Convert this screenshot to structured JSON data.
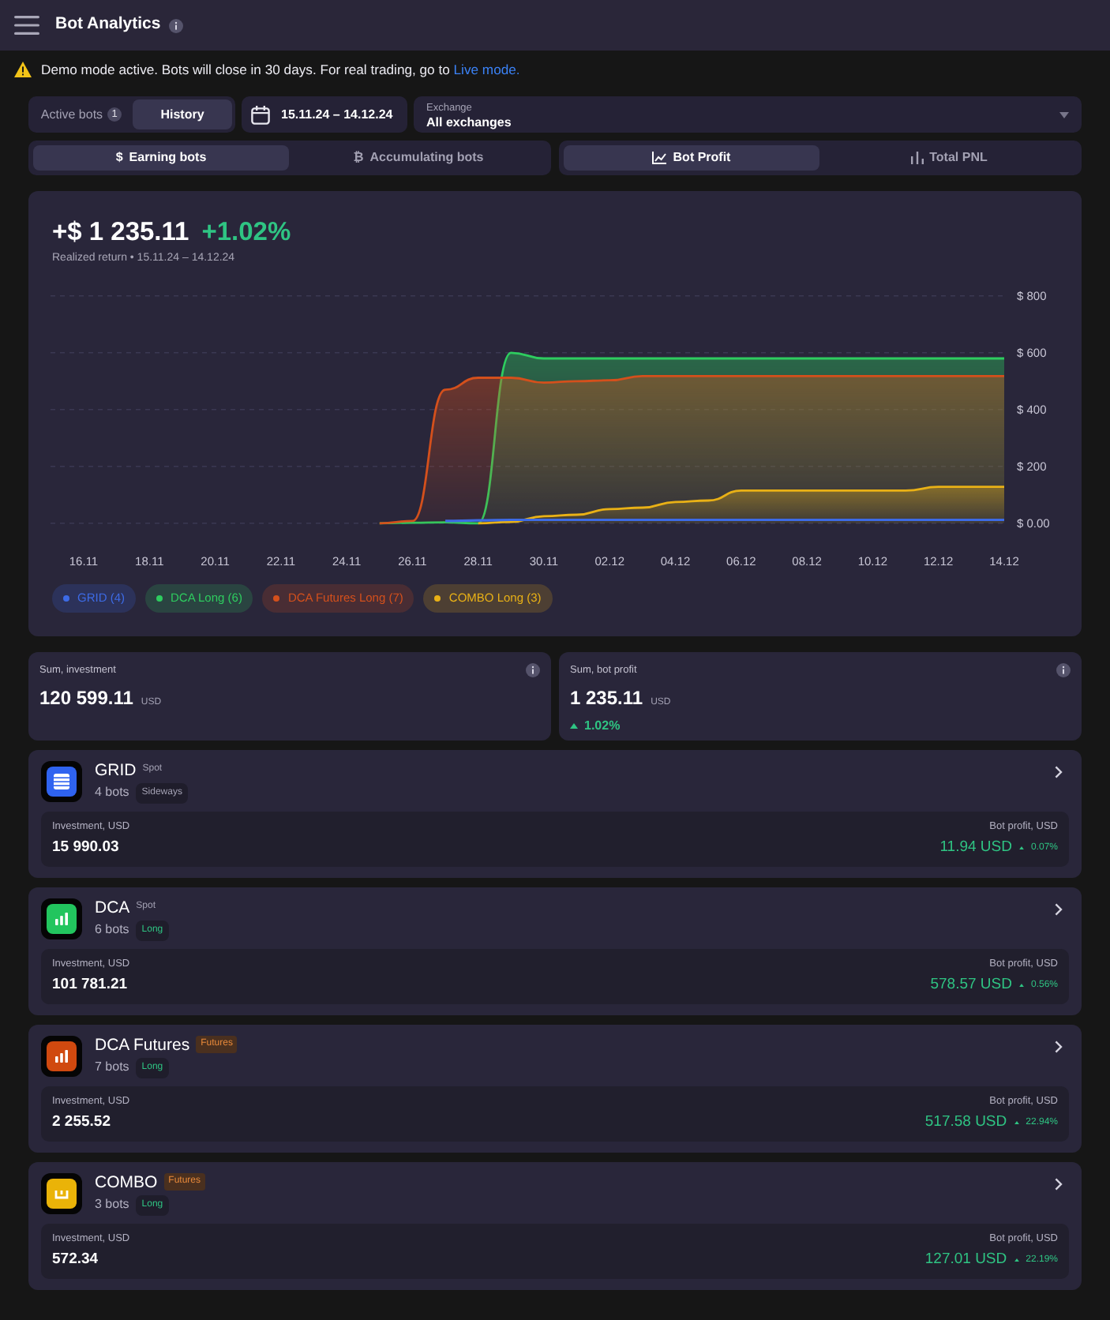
{
  "header": {
    "title": "Bot Analytics"
  },
  "notice": {
    "text": "Demo mode active. Bots will close in 30 days. For real trading, go to ",
    "link": "Live mode."
  },
  "mode_tabs": [
    {
      "label": "Active bots",
      "badge": "1",
      "selected": false
    },
    {
      "label": "History",
      "selected": true
    }
  ],
  "date_range": "15.11.24 – 14.12.24",
  "exchange": {
    "label": "Exchange",
    "value": "All exchanges"
  },
  "bot_type_tabs": [
    {
      "icon": "$",
      "label": "Earning bots",
      "selected": true
    },
    {
      "icon": "₿",
      "label": "Accumulating bots",
      "selected": false
    }
  ],
  "view_tabs": [
    {
      "kind": "line",
      "label": "Bot Profit",
      "selected": true
    },
    {
      "kind": "bars",
      "label": "Total PNL",
      "selected": false
    }
  ],
  "profit_chart": {
    "total": "+$ 1 235.11",
    "change": "+1.02%",
    "subtitle": "Realized return • 15.11.24 – 14.12.24",
    "chart_data": {
      "type": "area",
      "grid": true,
      "categories": [
        "16.11",
        null,
        "18.11",
        null,
        "20.11",
        null,
        "22.11",
        null,
        "24.11",
        null,
        "26.11",
        null,
        "28.11",
        null,
        "30.11",
        null,
        "02.12",
        null,
        "04.12",
        null,
        "06.12",
        null,
        "08.12",
        null,
        "10.12",
        null,
        "12.12",
        null,
        "14.12"
      ],
      "ylim": [
        0,
        800
      ],
      "yticks": [
        {
          "value": 800,
          "label": "$ 800"
        },
        {
          "value": 600,
          "label": "$ 600"
        },
        {
          "value": 400,
          "label": "$ 400"
        },
        {
          "value": 200,
          "label": "$ 200"
        },
        {
          "value": 0,
          "label": "$ 0.00"
        }
      ],
      "series": [
        {
          "name": "GRID (4)",
          "color": "#3d6be6",
          "type": "line",
          "values": [
            null,
            null,
            null,
            null,
            null,
            null,
            null,
            null,
            null,
            null,
            null,
            8,
            10,
            12,
            12,
            12,
            12,
            12,
            12,
            12,
            12,
            12,
            12,
            12,
            12,
            12,
            12,
            12,
            12
          ]
        },
        {
          "name": "DCA Long (6)",
          "color": "#2ecc5f",
          "values": [
            null,
            null,
            null,
            null,
            null,
            null,
            null,
            null,
            null,
            0,
            2,
            3,
            0,
            600,
            580,
            580,
            580,
            580,
            580,
            580,
            580,
            580,
            580,
            580,
            580,
            580,
            580,
            580,
            580
          ]
        },
        {
          "name": "DCA Futures Long (7)",
          "color": "#d4501c",
          "values": [
            null,
            null,
            null,
            null,
            null,
            null,
            null,
            null,
            null,
            0,
            8,
            470,
            512,
            512,
            495,
            500,
            503,
            518,
            518,
            518,
            518,
            518,
            518,
            518,
            518,
            518,
            518,
            518,
            518
          ]
        },
        {
          "name": "COMBO Long (3)",
          "color": "#e9b116",
          "values": [
            null,
            null,
            null,
            null,
            null,
            null,
            null,
            null,
            null,
            null,
            null,
            null,
            0,
            5,
            25,
            30,
            50,
            55,
            75,
            80,
            115,
            115,
            115,
            115,
            115,
            115,
            128,
            128,
            128
          ]
        }
      ]
    }
  },
  "summary": [
    {
      "label": "Sum, investment",
      "value": "120 599.11",
      "unit": "USD"
    },
    {
      "label": "Sum, bot profit",
      "value": "1 235.11",
      "unit": "USD",
      "change": "1.02%"
    }
  ],
  "bots": [
    {
      "name": "GRID",
      "kind": "grid",
      "color": "#2f63f0",
      "market": {
        "label": "Spot",
        "kind": "plain"
      },
      "count": "4 bots",
      "trend": {
        "label": "Sideways",
        "kind": "neutral"
      },
      "investment_label": "Investment, USD",
      "investment": "15 990.03",
      "profit_label": "Bot profit, USD",
      "profit": "11.94 USD",
      "change": "0.07%"
    },
    {
      "name": "DCA",
      "kind": "dca",
      "color": "#22c55e",
      "market": {
        "label": "Spot",
        "kind": "plain"
      },
      "count": "6 bots",
      "trend": {
        "label": "Long",
        "kind": "long"
      },
      "investment_label": "Investment, USD",
      "investment": "101 781.21",
      "profit_label": "Bot profit, USD",
      "profit": "578.57 USD",
      "change": "0.56%"
    },
    {
      "name": "DCA Futures",
      "kind": "dca",
      "color": "#d0490f",
      "market": {
        "label": "Futures",
        "kind": "futures"
      },
      "count": "7 bots",
      "trend": {
        "label": "Long",
        "kind": "long"
      },
      "investment_label": "Investment, USD",
      "investment": "2 255.52",
      "profit_label": "Bot profit, USD",
      "profit": "517.58 USD",
      "change": "22.94%"
    },
    {
      "name": "COMBO",
      "kind": "combo",
      "color": "#eab308",
      "market": {
        "label": "Futures",
        "kind": "futures"
      },
      "count": "3 bots",
      "trend": {
        "label": "Long",
        "kind": "long"
      },
      "investment_label": "Investment, USD",
      "investment": "572.34",
      "profit_label": "Bot profit, USD",
      "profit": "127.01 USD",
      "change": "22.19%"
    }
  ]
}
